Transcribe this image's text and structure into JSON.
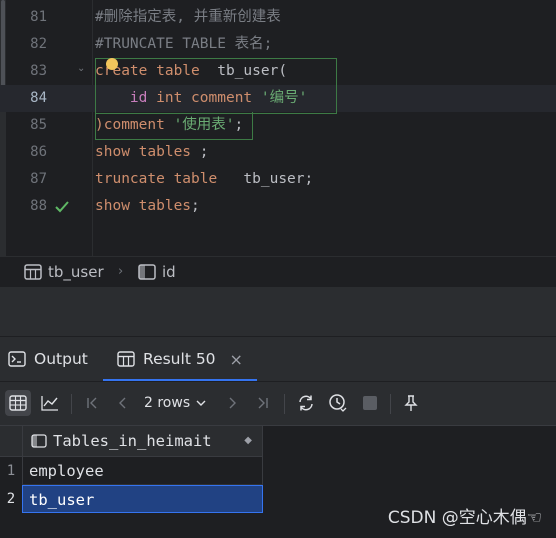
{
  "editor": {
    "lines": [
      {
        "num": "81",
        "tokens": [
          {
            "t": "#删除指定表, 并重新创建表",
            "c": "cm"
          }
        ]
      },
      {
        "num": "82",
        "tokens": [
          {
            "t": "#TRUNCATE TABLE 表名;",
            "c": "cm"
          }
        ]
      },
      {
        "num": "83",
        "tokens": [
          {
            "t": "create table  ",
            "c": "kw"
          },
          {
            "t": "tb_user(",
            "c": "pl"
          }
        ]
      },
      {
        "num": "84",
        "tokens": [
          {
            "t": "    ",
            "c": "pl"
          },
          {
            "t": "id ",
            "c": "id"
          },
          {
            "t": "int comment ",
            "c": "kw"
          },
          {
            "t": "'编号'",
            "c": "str"
          }
        ]
      },
      {
        "num": "85",
        "tokens": [
          {
            "t": ")",
            "c": "kw"
          },
          {
            "t": "comment ",
            "c": "kw"
          },
          {
            "t": "'使用表'",
            "c": "str"
          },
          {
            "t": ";",
            "c": "pl"
          }
        ]
      },
      {
        "num": "86",
        "tokens": [
          {
            "t": "show tables ",
            "c": "kw"
          },
          {
            "t": ";",
            "c": "pl"
          }
        ]
      },
      {
        "num": "87",
        "tokens": [
          {
            "t": "truncate table   ",
            "c": "kw"
          },
          {
            "t": "tb_user;",
            "c": "pl"
          }
        ]
      },
      {
        "num": "88",
        "tokens": [
          {
            "t": "show tables",
            "c": "kw"
          },
          {
            "t": ";",
            "c": "pl"
          }
        ]
      }
    ],
    "colors": {
      "keyword": "#cf8e6d",
      "string": "#6aab73",
      "comment": "#7a7e85",
      "column": "#c77dbb"
    }
  },
  "breadcrumb": {
    "items": [
      {
        "label": "tb_user",
        "icon": "table-icon"
      },
      {
        "label": "id",
        "icon": "column-icon"
      }
    ]
  },
  "toolwindow": {
    "tabs": [
      {
        "label": "Output",
        "icon": "console-icon"
      },
      {
        "label": "Result 50",
        "icon": "table-icon",
        "closable": true
      }
    ],
    "rows_label": "2 rows",
    "grid": {
      "column": "Tables_in_heimait",
      "rows": [
        {
          "num": "1",
          "value": "employee"
        },
        {
          "num": "2",
          "value": "tb_user"
        }
      ]
    }
  },
  "watermark": "CSDN @空心木偶☜"
}
